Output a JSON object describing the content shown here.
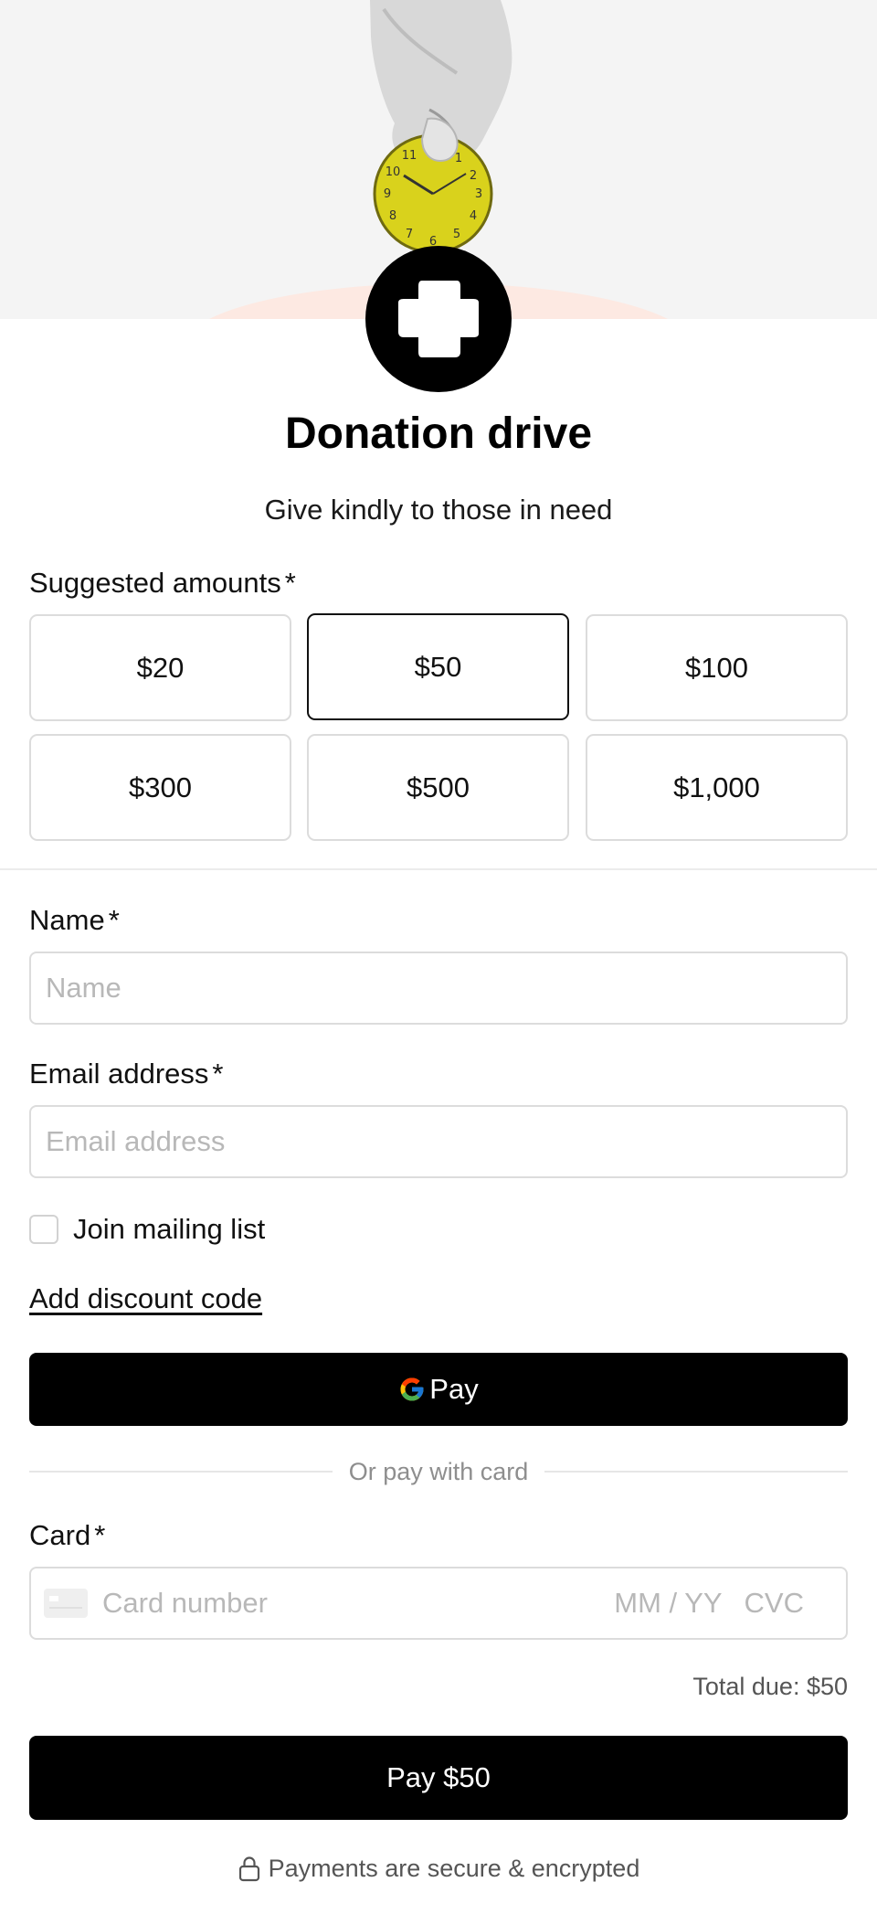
{
  "page": {
    "title": "Donation drive",
    "subtitle": "Give kindly to those in need"
  },
  "amounts": {
    "label": "Suggested amounts",
    "required_mark": "*",
    "options": [
      "$20",
      "$50",
      "$100",
      "$300",
      "$500",
      "$1,000"
    ],
    "selected": "$50"
  },
  "fields": {
    "name": {
      "label": "Name",
      "required_mark": "*",
      "placeholder": "Name",
      "value": ""
    },
    "email": {
      "label": "Email address",
      "required_mark": "*",
      "placeholder": "Email address",
      "value": ""
    }
  },
  "mailing_list": {
    "label": "Join mailing list",
    "checked": false
  },
  "discount_link": "Add discount code",
  "gpay": {
    "label": "Pay",
    "icon": "google-g-icon"
  },
  "separator": "Or pay with card",
  "card": {
    "label": "Card",
    "required_mark": "*",
    "number_placeholder": "Card number",
    "expiry_placeholder": "MM / YY",
    "cvc_placeholder": "CVC",
    "icon": "credit-card-icon"
  },
  "total": "Total due: $50",
  "pay_button": "Pay $50",
  "secure_note": {
    "text": "Payments are secure & encrypted",
    "icon": "lock-icon"
  },
  "colors": {
    "primary_button": "#000000",
    "hero_background": "#f4f4f4",
    "accent_arc": "#fde9e2",
    "coin": "#d9d21c",
    "border": "#dcdcdc"
  }
}
